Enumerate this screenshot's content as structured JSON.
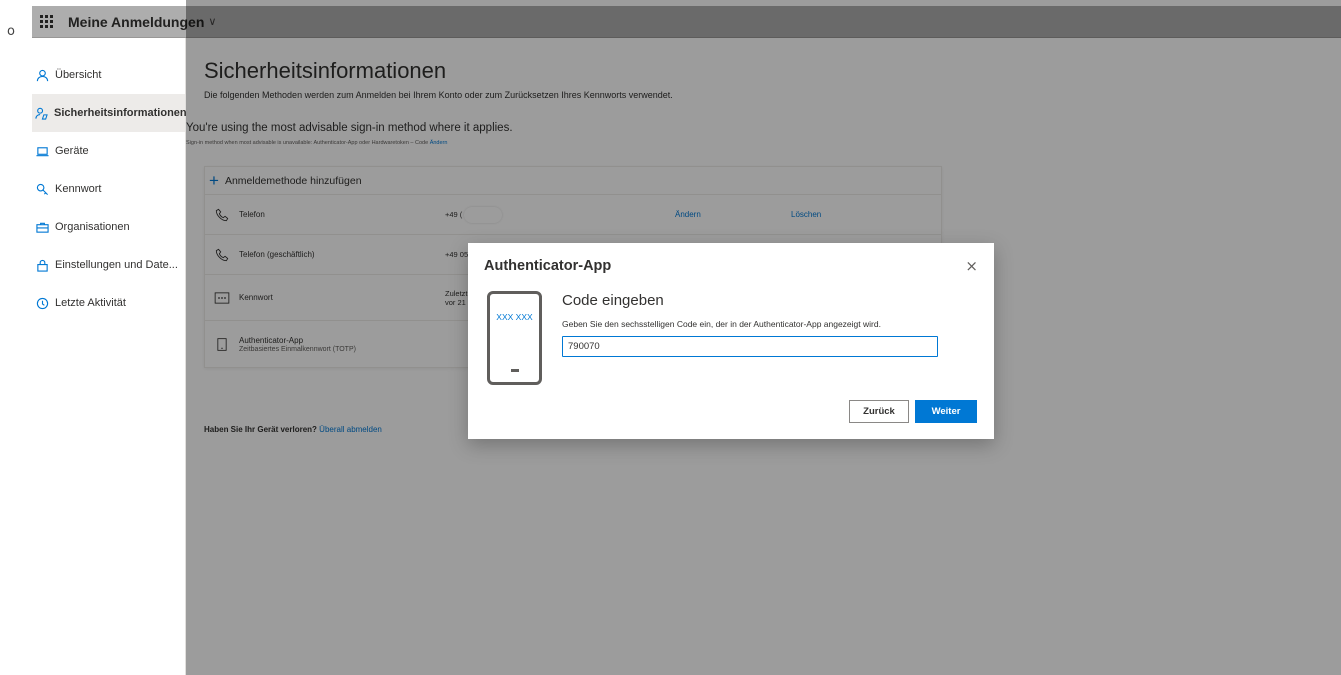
{
  "gutter_mark": "o",
  "topbar": {
    "app_name": "Meine Anmeldungen",
    "chevron": "∨"
  },
  "sidebar": {
    "items": [
      {
        "label": "Übersicht",
        "icon": "person-icon"
      },
      {
        "label": "Sicherheitsinformationen",
        "icon": "security-info-icon",
        "active": true
      },
      {
        "label": "Geräte",
        "icon": "laptop-icon"
      },
      {
        "label": "Kennwort",
        "icon": "key-icon"
      },
      {
        "label": "Organisationen",
        "icon": "briefcase-icon"
      },
      {
        "label": "Einstellungen und Date...",
        "icon": "lock-icon"
      },
      {
        "label": "Letzte Aktivität",
        "icon": "history-icon"
      }
    ]
  },
  "main": {
    "title": "Sicherheitsinformationen",
    "description": "Die folgenden Methoden werden zum Anmelden bei Ihrem Konto oder zum Zurücksetzen Ihres Kennworts verwendet.",
    "advisable_title": "You're using the most advisable sign-in method where it applies.",
    "advisable_sub": "Sign-in method when most advisable is unavailable: Authenticator-App oder Hardwaretoken – Code",
    "advisable_link": "Ändern",
    "add_method": "Anmeldemethode hinzufügen",
    "methods": [
      {
        "label": "Telefon",
        "value": "+49 (",
        "edit": "Ändern",
        "delete": "Löschen"
      },
      {
        "label": "Telefon (geschäftlich)",
        "value": "+49 05"
      },
      {
        "label": "Kennwort",
        "value_line1": "Zuletzt",
        "value_line2": "vor 21"
      },
      {
        "label": "Authenticator-App",
        "sub": "Zeitbasiertes Einmalkennwort (TOTP)"
      }
    ],
    "lost_bold": "Haben Sie Ihr Gerät verloren?",
    "lost_link": "Überall abmelden"
  },
  "dialog": {
    "title": "Authenticator-App",
    "close": "×",
    "phone_code": "XXX XXX",
    "heading": "Code eingeben",
    "description": "Geben Sie den sechsstelligen Code ein, der in der Authenticator-App angezeigt wird.",
    "code_value": "790070",
    "back_label": "Zurück",
    "next_label": "Weiter"
  },
  "colors": {
    "accent": "#0078d4",
    "text": "#323130",
    "overlay": "rgba(0,0,0,0.39)"
  }
}
